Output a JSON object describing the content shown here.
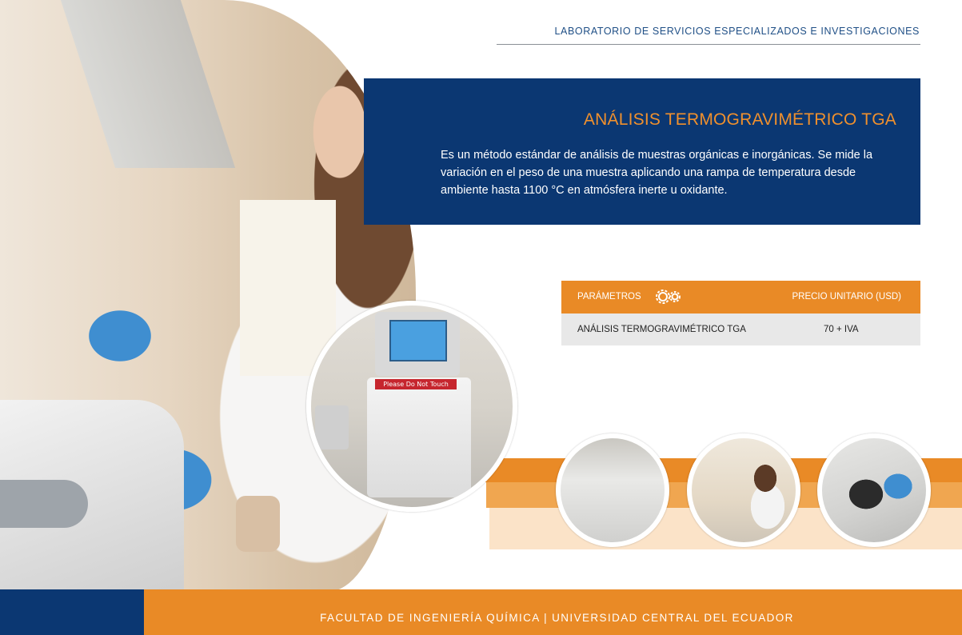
{
  "header": {
    "organization": "LABORATORIO DE SERVICIOS ESPECIALIZADOS E INVESTIGACIONES"
  },
  "info": {
    "title": "ANÁLISIS TERMOGRAVIMÉTRICO TGA",
    "description": "Es un método estándar de análisis de muestras orgánicas e inorgánicas. Se mide la variación en el peso de una muestra aplicando una rampa de temperatura desde ambiente hasta 1100 °C en atmósfera inerte u oxidante."
  },
  "table": {
    "col_parameters": "PARÁMETROS",
    "col_price": "PRECIO UNITARIO (USD)",
    "rows": [
      {
        "name": "ANÁLISIS TERMOGRAVIMÉTRICO TGA",
        "price": "70 + IVA"
      }
    ]
  },
  "equipment_photo": {
    "sign_text": "Please Do Not Touch"
  },
  "footer": {
    "text": "FACULTAD DE INGENIERÍA QUÍMICA | UNIVERSIDAD CENTRAL DEL ECUADOR"
  },
  "colors": {
    "navy": "#0b3772",
    "orange": "#e98a26",
    "light_orange": "#fbe3c8",
    "header_blue": "#1f4f86"
  },
  "icons": [
    "gears-icon"
  ]
}
